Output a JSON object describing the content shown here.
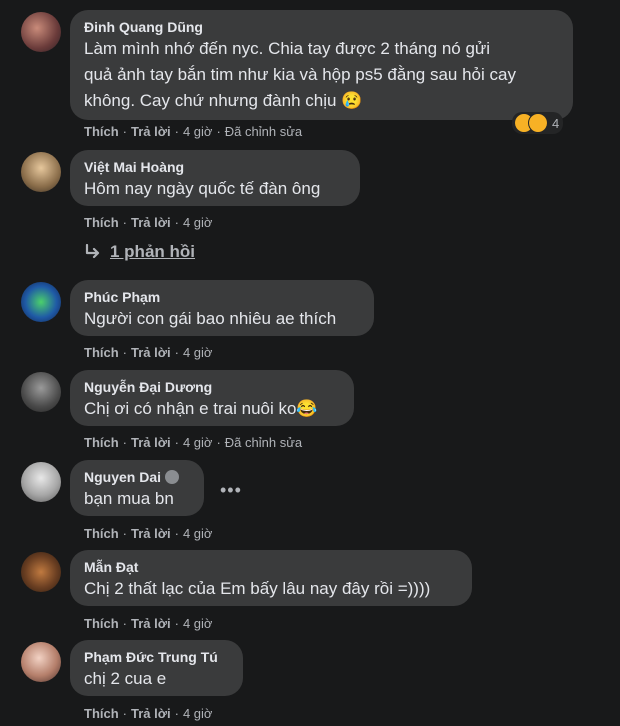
{
  "comments": [
    {
      "name": "Đinh Quang Dũng",
      "lines": [
        "Làm mình nhớ đến nyc. Chia tay được 2 tháng nó gửi",
        "quả ảnh tay bắn tim như kia và hộp ps5 đằng sau hỏi cay",
        "không. Cay chứ nhưng đành chịu 😢"
      ],
      "like": "Thích",
      "reply": "Trả lời",
      "time": "4 giờ",
      "edited": "Đã chỉnh sửa",
      "reaction_icons": [
        "laugh-emoji",
        "wow-emoji"
      ],
      "reaction_count": "4"
    },
    {
      "name": "Việt Mai Hoàng",
      "lines": [
        "Hôm nay ngày quốc tế đàn ông"
      ],
      "like": "Thích",
      "reply": "Trả lời",
      "time": "4 giờ",
      "replies_label": "1 phản hồi"
    },
    {
      "name": "Phúc Phạm",
      "lines": [
        "Người con gái bao nhiêu ae thích"
      ],
      "like": "Thích",
      "reply": "Trả lời",
      "time": "4 giờ"
    },
    {
      "name": "Nguyễn Đại Dương",
      "lines": [
        "Chị ơi có nhận e trai nuôi ko😂"
      ],
      "like": "Thích",
      "reply": "Trả lời",
      "time": "4 giờ",
      "edited": "Đã chỉnh sửa"
    },
    {
      "name": "Nguyen Dai",
      "name_badge_icon": "wave-hand-icon",
      "lines": [
        "bạn mua bn"
      ],
      "like": "Thích",
      "reply": "Trả lời",
      "time": "4 giờ",
      "more_label": "•••"
    },
    {
      "name": "Mẫn Đạt",
      "lines": [
        "Chị 2 thất lạc của Em bấy lâu nay đây rồi =))))"
      ],
      "like": "Thích",
      "reply": "Trả lời",
      "time": "4 giờ"
    },
    {
      "name": "Phạm Đức Trung Tú",
      "lines": [
        "chị 2 cua e"
      ],
      "like": "Thích",
      "reply": "Trả lời",
      "time": "4 giờ"
    }
  ],
  "colors": {
    "background": "#18191a",
    "bubble": "#3a3b3c",
    "text": "#e4e6eb",
    "muted": "#b0b3b8"
  }
}
